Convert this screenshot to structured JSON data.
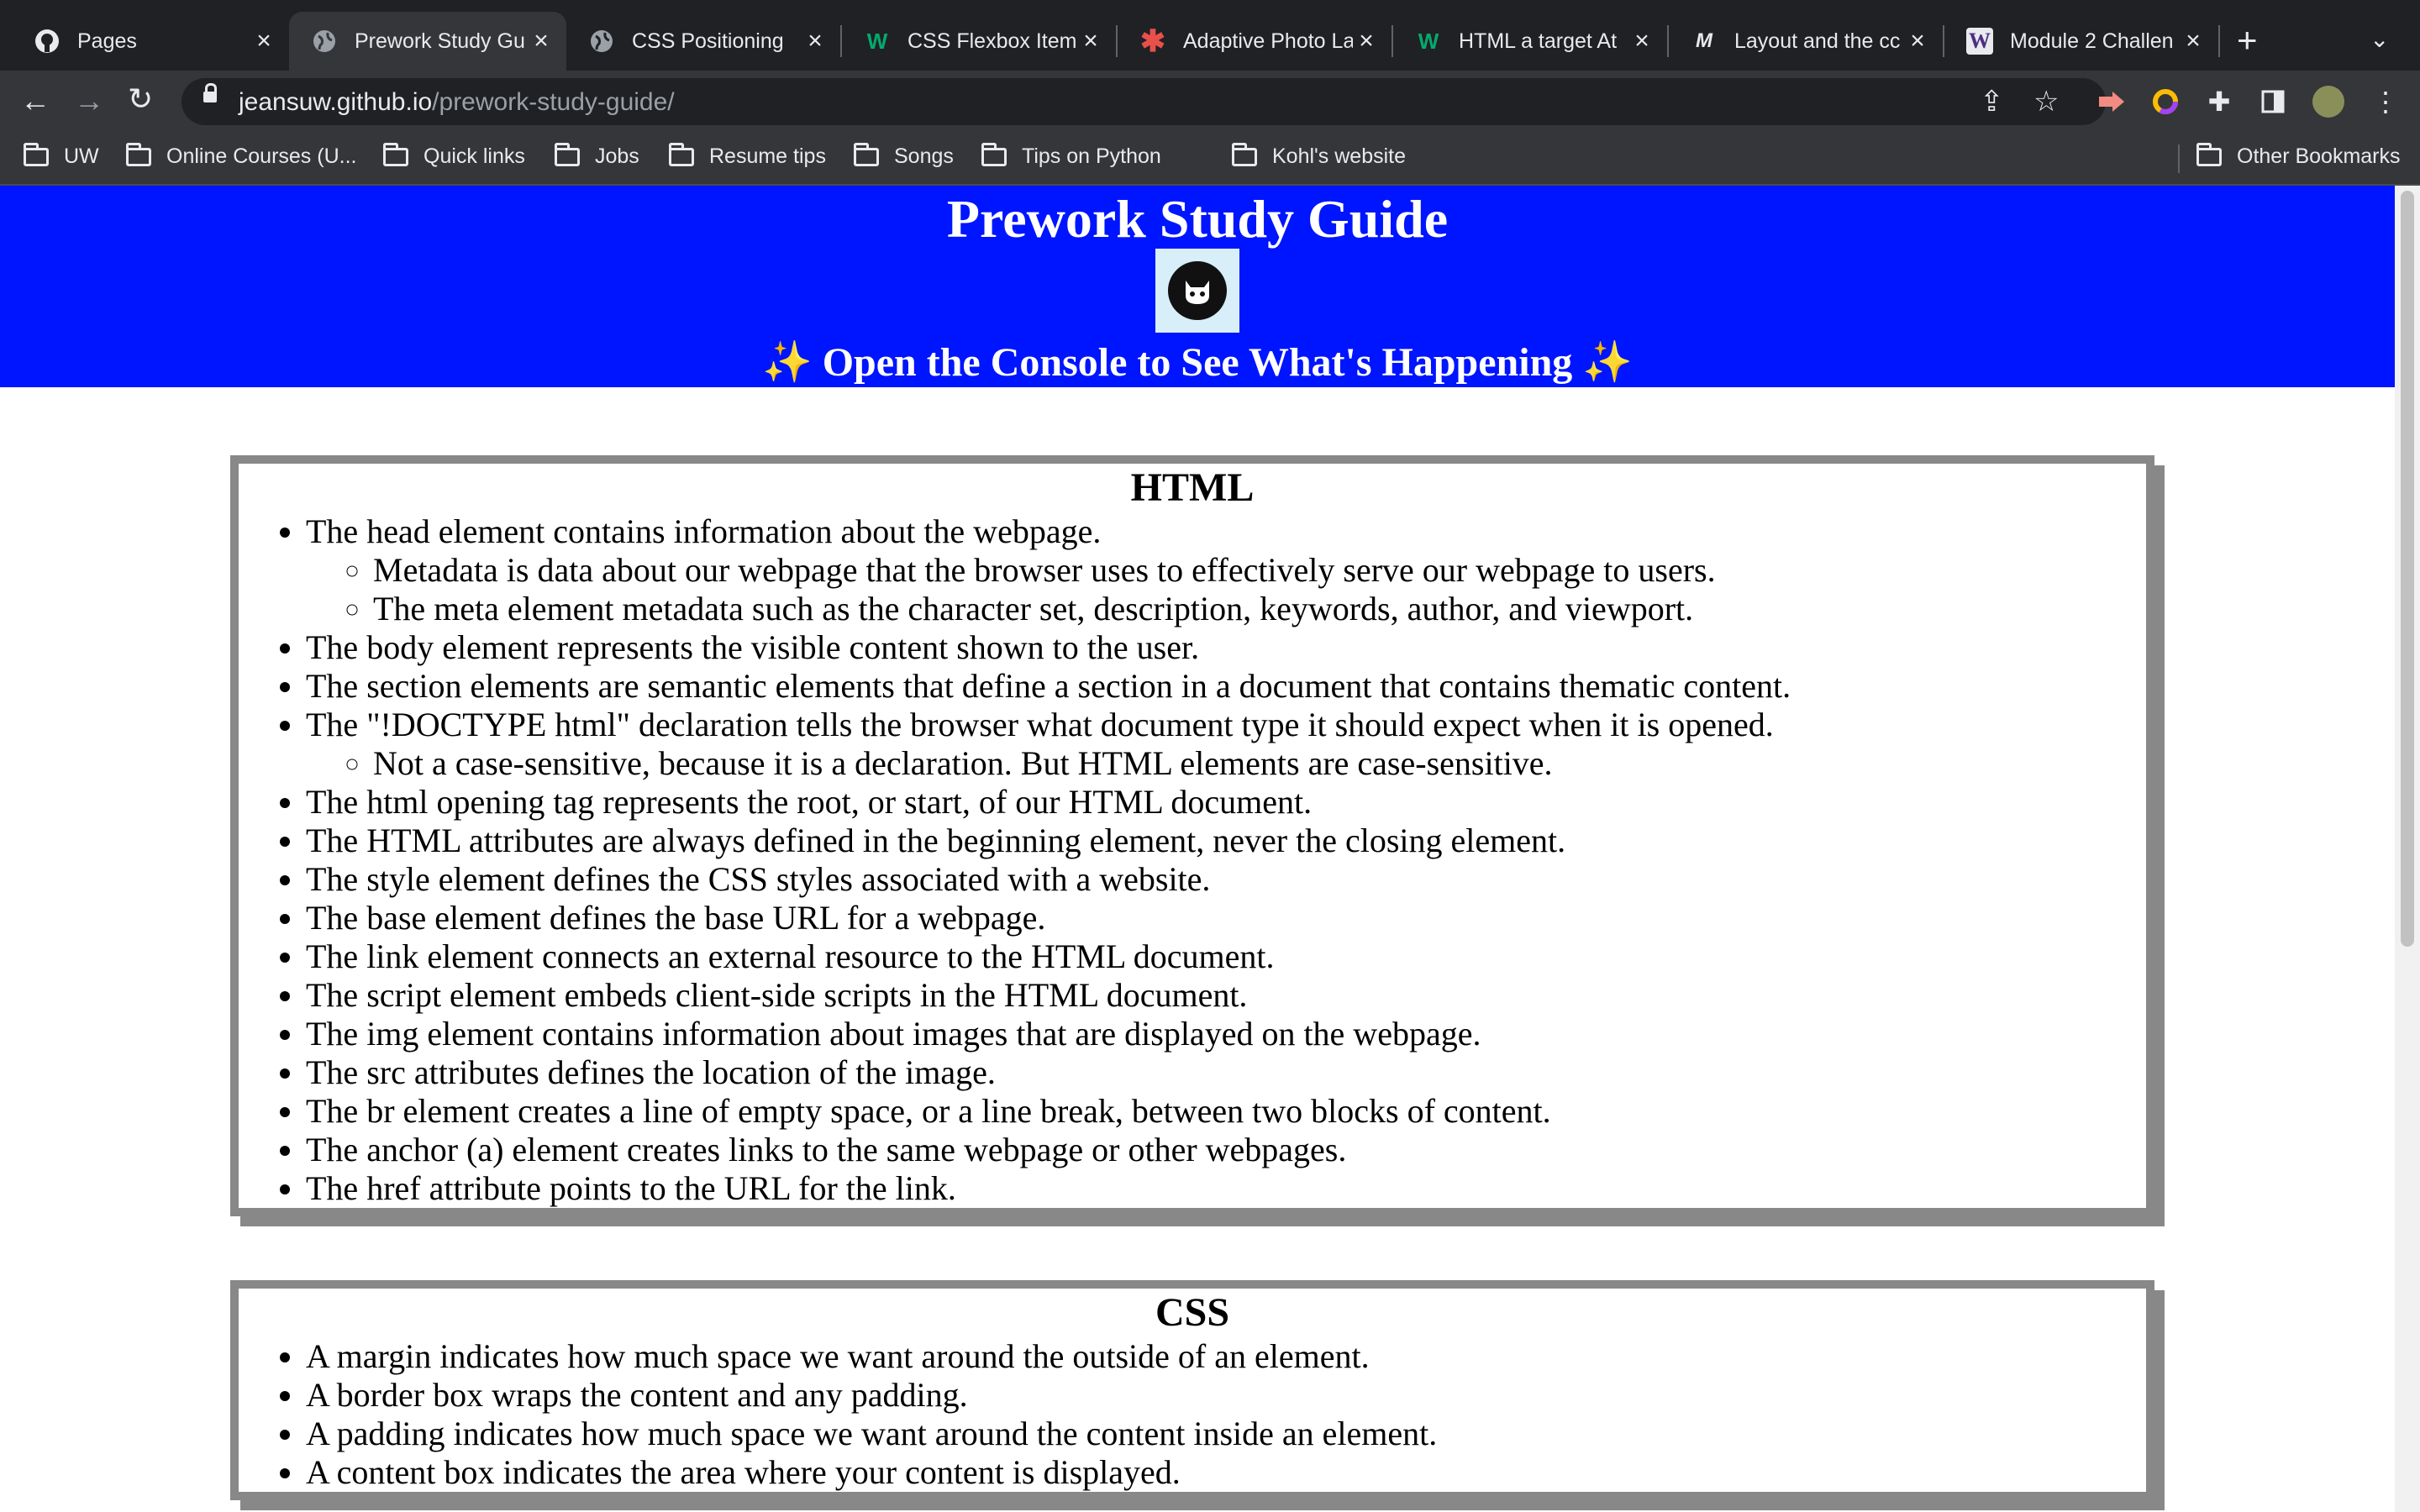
{
  "browser": {
    "tabs": [
      {
        "label": "Pages",
        "icon": "github-icon",
        "active": false
      },
      {
        "label": "Prework Study Gu",
        "icon": "globe-icon",
        "active": true
      },
      {
        "label": "CSS Positioning",
        "icon": "globe-icon",
        "active": false
      },
      {
        "label": "CSS Flexbox Item",
        "icon": "w3-icon",
        "active": false
      },
      {
        "label": "Adaptive Photo La",
        "icon": "asterisk-icon",
        "active": false
      },
      {
        "label": "HTML a target At",
        "icon": "w3-icon",
        "active": false
      },
      {
        "label": "Layout and the cc",
        "icon": "m-icon",
        "active": false
      },
      {
        "label": "Module 2 Challen",
        "icon": "w-icon",
        "active": false
      }
    ],
    "url": {
      "host": "jeansuw.github.io",
      "path": "/prework-study-guide/"
    },
    "bookmarks": [
      "UW",
      "Online Courses (U...",
      "Quick links",
      "Jobs",
      "Resume tips",
      "Songs",
      "Tips on Python",
      "Kohl's website"
    ],
    "other_bookmarks": "Other Bookmarks"
  },
  "page": {
    "title": "Prework Study Guide",
    "subtitle": "Open the Console to See What's Happening",
    "sparkle": "✨",
    "sections": [
      {
        "heading": "HTML",
        "items": [
          {
            "text": "The head element contains information about the webpage.",
            "sub": [
              "Metadata is data about our webpage that the browser uses to effectively serve our webpage to users.",
              "The meta element metadata such as the character set, description, keywords, author, and viewport."
            ]
          },
          {
            "text": "The body element represents the visible content shown to the user.",
            "sub": []
          },
          {
            "text": "The section elements are semantic elements that define a section in a document that contains thematic content.",
            "sub": []
          },
          {
            "text": "The \"!DOCTYPE html\" declaration tells the browser what document type it should expect when it is opened.",
            "sub": [
              "Not a case-sensitive, because it is a declaration. But HTML elements are case-sensitive."
            ]
          },
          {
            "text": "The html opening tag represents the root, or start, of our HTML document.",
            "sub": []
          },
          {
            "text": "The HTML attributes are always defined in the beginning element, never the closing element.",
            "sub": []
          },
          {
            "text": "The style element defines the CSS styles associated with a website.",
            "sub": []
          },
          {
            "text": "The base element defines the base URL for a webpage.",
            "sub": []
          },
          {
            "text": "The link element connects an external resource to the HTML document.",
            "sub": []
          },
          {
            "text": "The script element embeds client-side scripts in the HTML document.",
            "sub": []
          },
          {
            "text": "The img element contains information about images that are displayed on the webpage.",
            "sub": []
          },
          {
            "text": "The src attributes defines the location of the image.",
            "sub": []
          },
          {
            "text": "The br element creates a line of empty space, or a line break, between two blocks of content.",
            "sub": []
          },
          {
            "text": "The anchor (a) element creates links to the same webpage or other webpages.",
            "sub": []
          },
          {
            "text": "The href attribute points to the URL for the link.",
            "sub": []
          }
        ]
      },
      {
        "heading": "CSS",
        "items": [
          {
            "text": "A margin indicates how much space we want around the outside of an element.",
            "sub": []
          },
          {
            "text": "A border box wraps the content and any padding.",
            "sub": []
          },
          {
            "text": "A padding indicates how much space we want around the content inside an element.",
            "sub": []
          },
          {
            "text": "A content box indicates the area where your content is displayed.",
            "sub": []
          }
        ]
      }
    ]
  },
  "colors": {
    "header_bg": "#0015ff",
    "card_border": "#888888",
    "chrome_bg": "#35363a",
    "tabstrip_bg": "#202124"
  }
}
